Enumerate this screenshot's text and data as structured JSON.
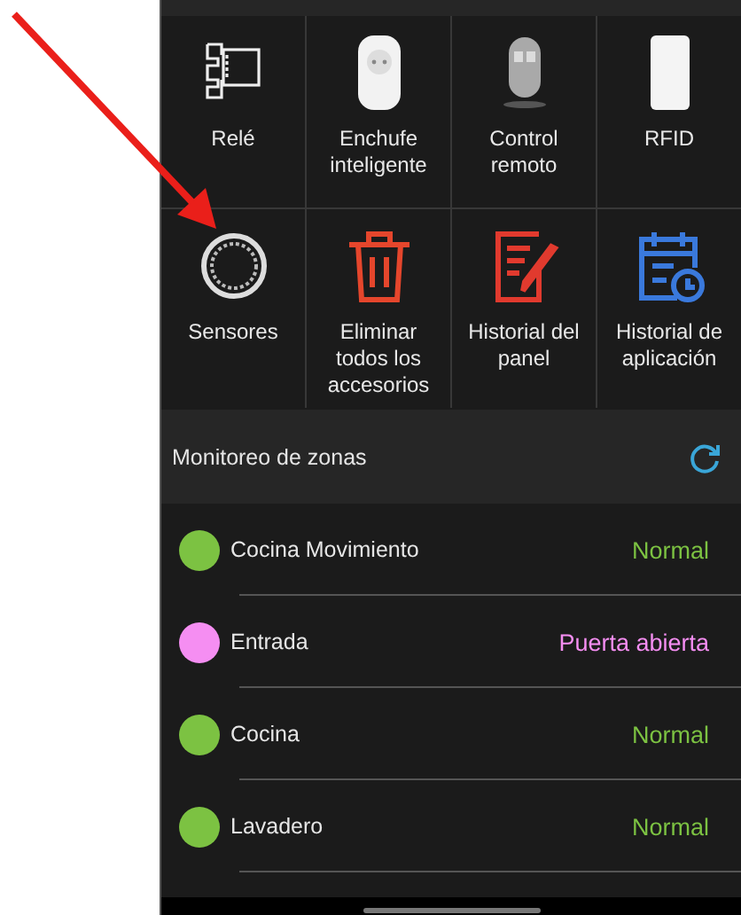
{
  "tiles": [
    {
      "kind": "relay",
      "label": "Relé"
    },
    {
      "kind": "plug",
      "label": "Enchufe inteligente"
    },
    {
      "kind": "remote",
      "label": "Control remoto"
    },
    {
      "kind": "card",
      "label": "RFID"
    },
    {
      "kind": "ring",
      "label": "Sensores"
    },
    {
      "kind": "trash",
      "label": "Eliminar todos los accesorios"
    },
    {
      "kind": "document",
      "label": "Historial del panel"
    },
    {
      "kind": "calendar",
      "label": "Historial de aplicación"
    }
  ],
  "zones": {
    "title": "Monitoreo de zonas",
    "items": [
      {
        "name": "Cocina Movimiento",
        "status": "Normal",
        "color": "#7cc242"
      },
      {
        "name": "Entrada",
        "status": "Puerta abierta",
        "color": "#f58ef2"
      },
      {
        "name": "Cocina",
        "status": "Normal",
        "color": "#7cc242"
      },
      {
        "name": "Lavadero",
        "status": "Normal",
        "color": "#7cc242"
      }
    ]
  }
}
